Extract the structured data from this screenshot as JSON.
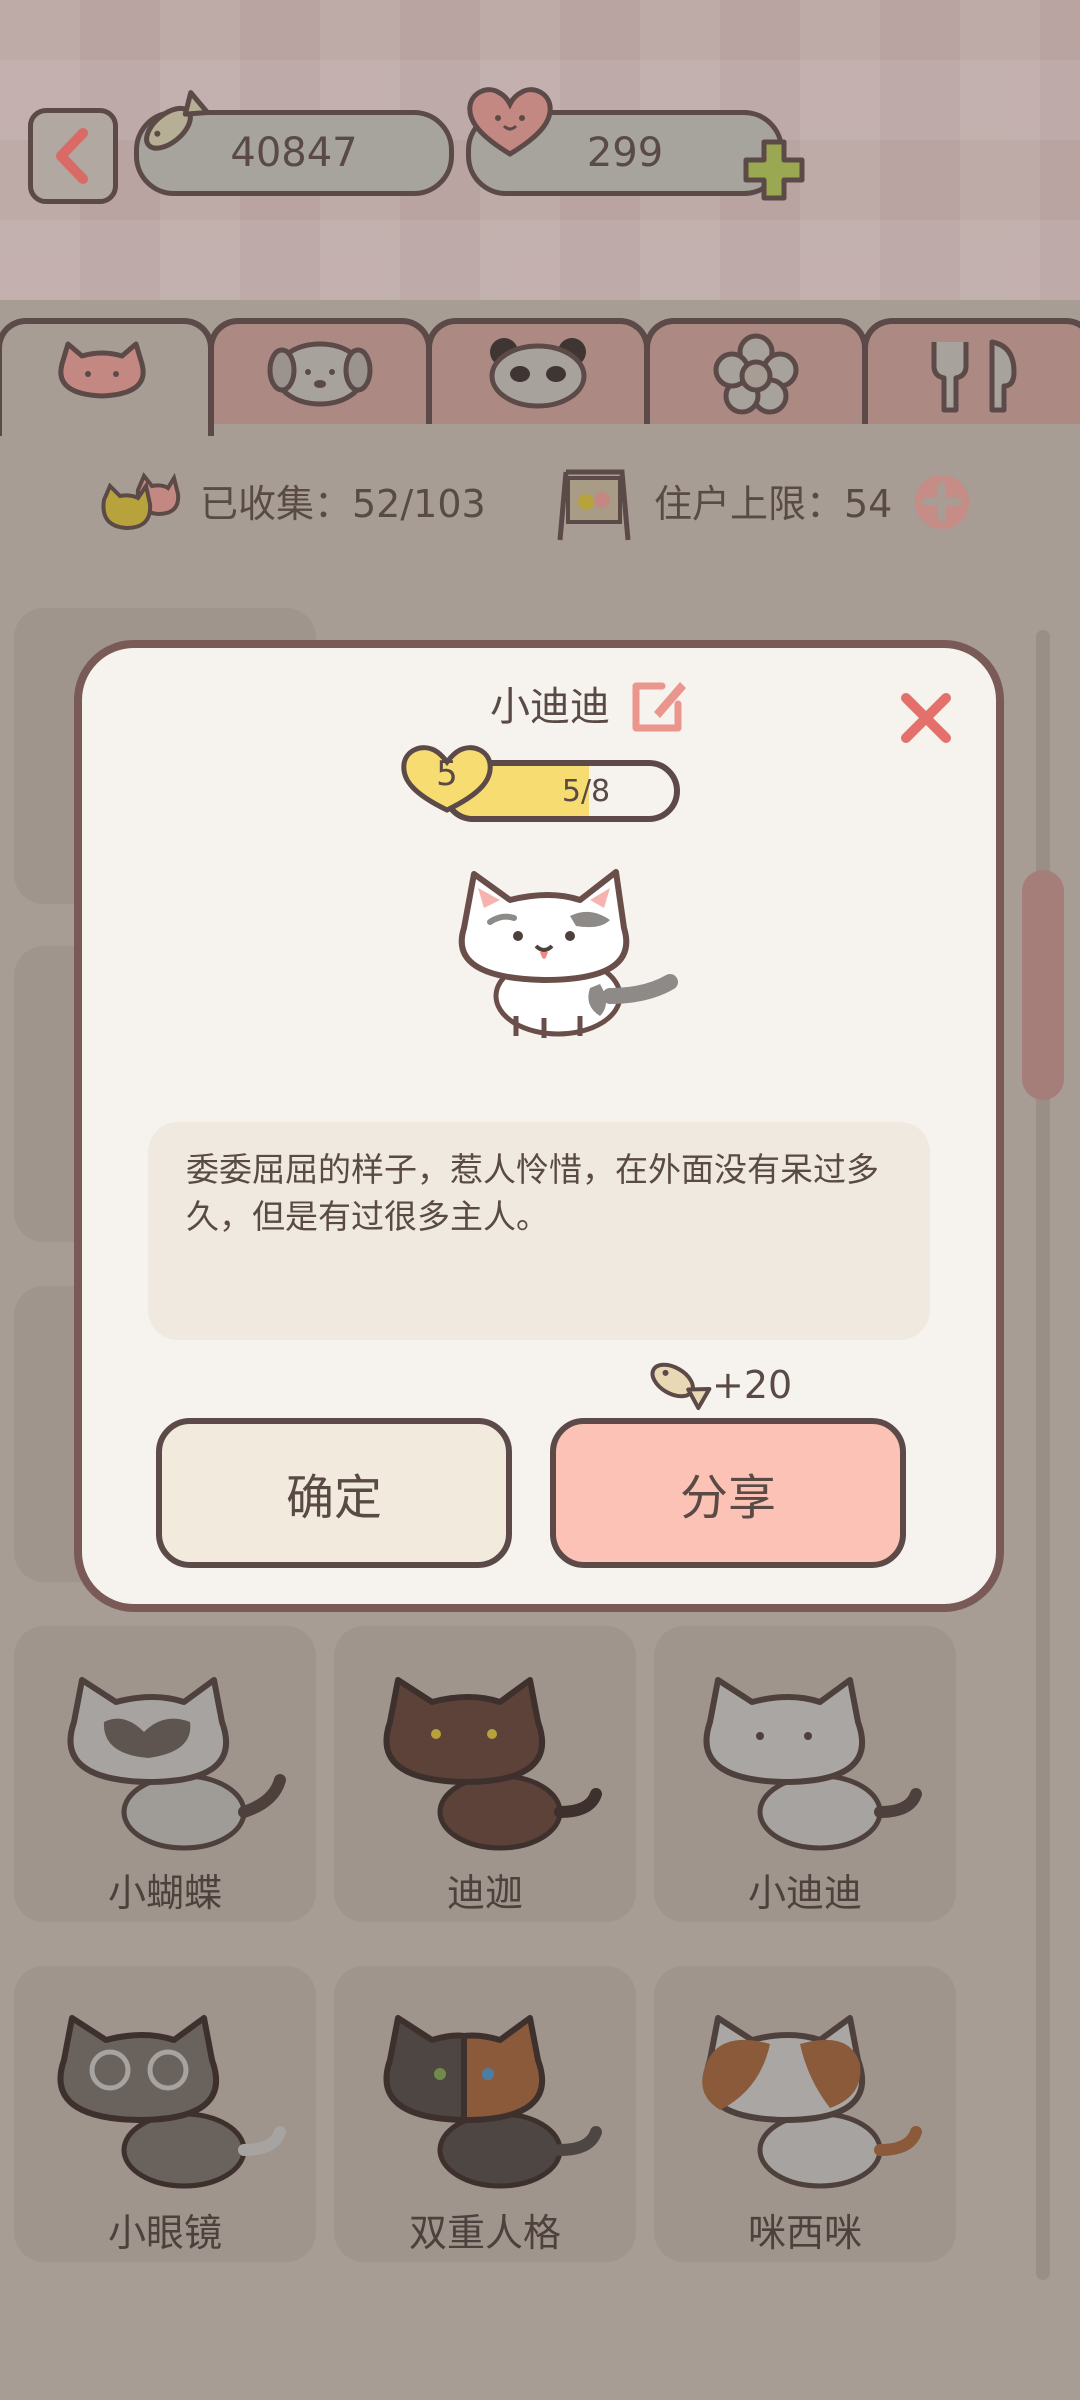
{
  "header": {
    "fish_count": "40847",
    "heart_count": "299"
  },
  "tabs": [
    {
      "icon": "cat-tab-icon",
      "active": true
    },
    {
      "icon": "dog-tab-icon",
      "active": false
    },
    {
      "icon": "panda-tab-icon",
      "active": false
    },
    {
      "icon": "flower-tab-icon",
      "active": false
    },
    {
      "icon": "utensils-tab-icon",
      "active": false
    }
  ],
  "stats": {
    "collected_label": "已收集：52/103",
    "resident_label": "住户上限：54"
  },
  "modal": {
    "cat_name": "小迪迪",
    "level": "5",
    "progress_text": "5/8",
    "progress_fraction": 0.625,
    "description": "委委屈屈的样子，惹人怜惜，在外面没有呆过多久，但是有过很多主人。",
    "reward": "+20",
    "confirm_label": "确定",
    "share_label": "分享"
  },
  "grid": {
    "row1": [
      "小蝴蝶",
      "迪迦",
      "小迪迪"
    ],
    "row2": [
      "小眼镜",
      "双重人格",
      "咪西咪"
    ]
  },
  "colors": {
    "accent_red": "#e4706c",
    "share_button": "#fdc2b6",
    "confirm_button": "#f2ebdd",
    "level_yellow": "#f7dc72",
    "outline": "#5b4a47"
  }
}
